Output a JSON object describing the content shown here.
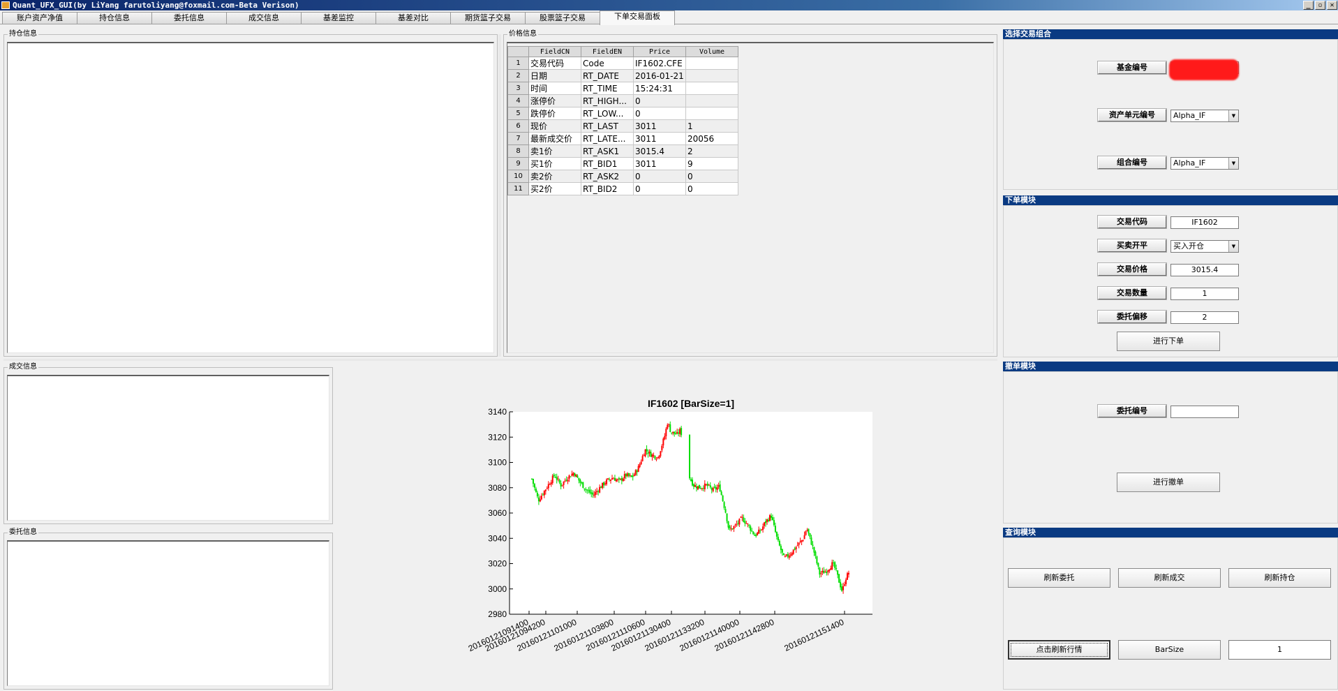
{
  "window": {
    "title": "Quant_UFX_GUI(by LiYang farutoliyang@foxmail.com-Beta Verison)",
    "app_icon": "app-icon",
    "controls": {
      "minimize": "_",
      "maximize": "▫",
      "close": "✕"
    }
  },
  "tabs": [
    "账户资产净值",
    "持仓信息",
    "委托信息",
    "成交信息",
    "基差监控",
    "基差对比",
    "期货篮子交易",
    "股票篮子交易",
    "下单交易面板"
  ],
  "active_tab": "下单交易面板",
  "positions": {
    "title": "持仓信息"
  },
  "price": {
    "title": "价格信息",
    "columns": [
      "FieldCN",
      "FieldEN",
      "Price",
      "Volume"
    ],
    "rows": [
      [
        "交易代码",
        "Code",
        "IF1602.CFE",
        ""
      ],
      [
        "日期",
        "RT_DATE",
        "2016-01-21",
        ""
      ],
      [
        "时间",
        "RT_TIME",
        "15:24:31",
        ""
      ],
      [
        "涨停价",
        "RT_HIGH...",
        "0",
        ""
      ],
      [
        "跌停价",
        "RT_LOW...",
        "0",
        ""
      ],
      [
        "现价",
        "RT_LAST",
        "3011",
        "1"
      ],
      [
        "最新成交价",
        "RT_LATE...",
        "3011",
        "20056"
      ],
      [
        "卖1价",
        "RT_ASK1",
        "3015.4",
        "2"
      ],
      [
        "买1价",
        "RT_BID1",
        "3011",
        "9"
      ],
      [
        "卖2价",
        "RT_ASK2",
        "0",
        "0"
      ],
      [
        "买2价",
        "RT_BID2",
        "0",
        "0"
      ]
    ]
  },
  "trades": {
    "title": "成交信息"
  },
  "orders": {
    "title": "委托信息"
  },
  "portfolio": {
    "header": "选择交易组合",
    "fund_label": "基金编号",
    "fund_value": "",
    "asset_unit_label": "资产单元编号",
    "asset_unit_value": "Alpha_IF",
    "combo_label": "组合编号",
    "combo_value": "Alpha_IF"
  },
  "order_entry": {
    "header": "下单模块",
    "code_label": "交易代码",
    "code_value": "IF1602",
    "side_label": "买卖开平",
    "side_value": "买入开仓",
    "price_label": "交易价格",
    "price_value": "3015.4",
    "qty_label": "交易数量",
    "qty_value": "1",
    "offset_label": "委托偏移",
    "offset_value": "2",
    "submit": "进行下单"
  },
  "cancel": {
    "header": "撤单模块",
    "order_no_label": "委托编号",
    "order_no_value": "",
    "submit": "进行撤单"
  },
  "query": {
    "header": "查询模块",
    "refresh_orders": "刷新委托",
    "refresh_trades": "刷新成交",
    "refresh_positions": "刷新持仓",
    "refresh_quotes": "点击刷新行情",
    "barsize_label": "BarSize",
    "barsize_value": "1"
  },
  "chart_data": {
    "type": "candlestick",
    "title": "IF1602 [BarSize=1]",
    "ylim": [
      2980,
      3140
    ],
    "yticks": [
      2980,
      3000,
      3020,
      3040,
      3060,
      3080,
      3100,
      3120,
      3140
    ],
    "xticks": [
      "20160121091400",
      "20160121094200",
      "20160121101000",
      "20160121103800",
      "20160121110600",
      "20160121130400",
      "20160121133200",
      "20160121140000",
      "20160121142800",
      "20160121151400"
    ],
    "grid": false,
    "up_color": "#ff0000",
    "down_color": "#00dd00",
    "close_path": [
      [
        0.0,
        3087
      ],
      [
        0.02,
        3070
      ],
      [
        0.04,
        3078
      ],
      [
        0.07,
        3090
      ],
      [
        0.09,
        3082
      ],
      [
        0.11,
        3088
      ],
      [
        0.13,
        3092
      ],
      [
        0.15,
        3084
      ],
      [
        0.17,
        3078
      ],
      [
        0.19,
        3074
      ],
      [
        0.21,
        3080
      ],
      [
        0.23,
        3085
      ],
      [
        0.25,
        3088
      ],
      [
        0.27,
        3085
      ],
      [
        0.29,
        3090
      ],
      [
        0.31,
        3088
      ],
      [
        0.33,
        3096
      ],
      [
        0.35,
        3110
      ],
      [
        0.37,
        3106
      ],
      [
        0.39,
        3104
      ],
      [
        0.41,
        3120
      ],
      [
        0.42,
        3132
      ],
      [
        0.43,
        3124
      ],
      [
        0.45,
        3122
      ],
      [
        0.46,
        3126
      ],
      [
        0.47,
        3112
      ],
      [
        0.48,
        3092
      ],
      [
        0.5,
        3082
      ],
      [
        0.52,
        3080
      ],
      [
        0.54,
        3082
      ],
      [
        0.56,
        3078
      ],
      [
        0.58,
        3081
      ],
      [
        0.6,
        3060
      ],
      [
        0.61,
        3046
      ],
      [
        0.63,
        3050
      ],
      [
        0.65,
        3056
      ],
      [
        0.67,
        3050
      ],
      [
        0.69,
        3042
      ],
      [
        0.71,
        3047
      ],
      [
        0.72,
        3052
      ],
      [
        0.74,
        3058
      ],
      [
        0.76,
        3038
      ],
      [
        0.78,
        3024
      ],
      [
        0.8,
        3028
      ],
      [
        0.82,
        3034
      ],
      [
        0.84,
        3040
      ],
      [
        0.85,
        3048
      ],
      [
        0.87,
        3032
      ],
      [
        0.89,
        3012
      ],
      [
        0.91,
        3014
      ],
      [
        0.93,
        3020
      ],
      [
        0.94,
        3015
      ],
      [
        0.95,
        3006
      ],
      [
        0.96,
        2998
      ],
      [
        0.97,
        3008
      ],
      [
        0.98,
        3013
      ]
    ]
  }
}
